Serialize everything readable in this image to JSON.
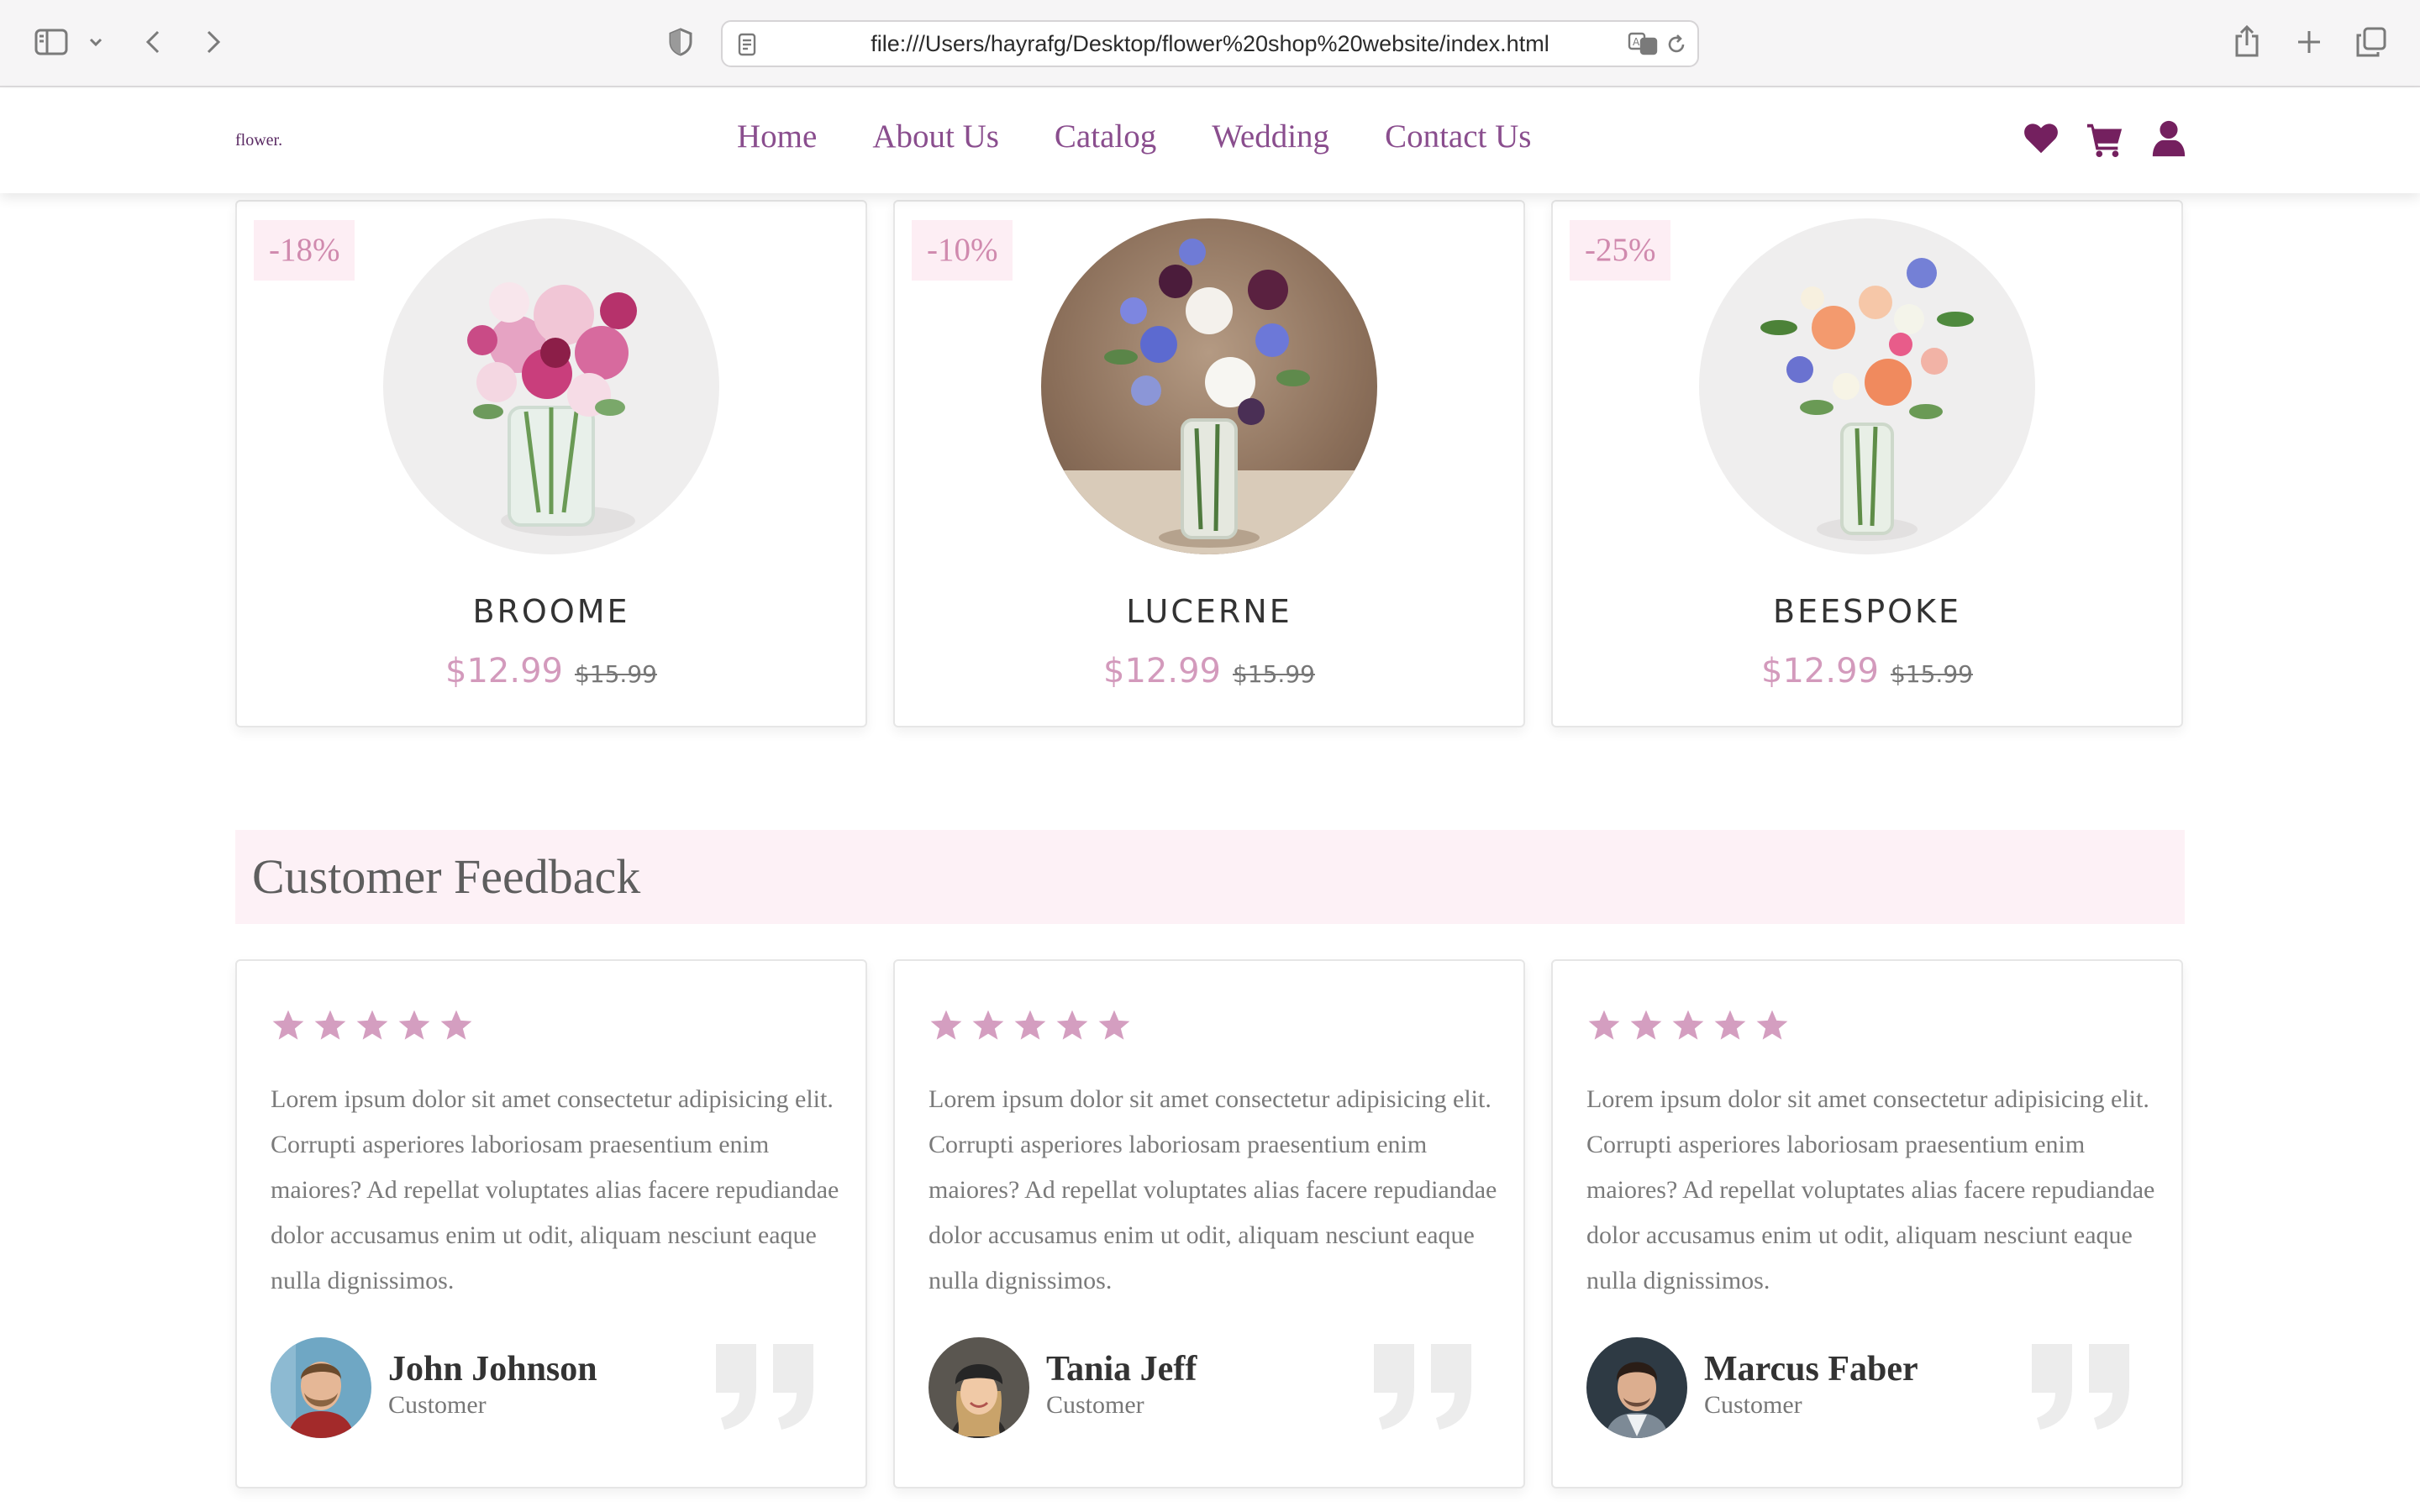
{
  "browser": {
    "url": "file:///Users/hayrafg/Desktop/flower%20shop%20website/index.html"
  },
  "header": {
    "logo": "flower.",
    "nav": [
      "Home",
      "About Us",
      "Catalog",
      "Wedding",
      "Contact Us"
    ],
    "icons": [
      "heart-icon",
      "cart-icon",
      "user-icon"
    ],
    "accent_color": "#74205f"
  },
  "products": [
    {
      "discount": "-18%",
      "name": "BROOME",
      "price": "$12.99",
      "old_price": "$15.99"
    },
    {
      "discount": "-10%",
      "name": "LUCERNE",
      "price": "$12.99",
      "old_price": "$15.99"
    },
    {
      "discount": "-25%",
      "name": "BEESPOKE",
      "price": "$12.99",
      "old_price": "$15.99"
    }
  ],
  "feedback": {
    "title": "Customer Feedback",
    "reviews": [
      {
        "rating": 5,
        "text": "Lorem ipsum dolor sit amet consectetur adipisicing elit. Corrupti asperiores laboriosam praesentium enim maiores? Ad repellat voluptates alias facere repudiandae dolor accusamus enim ut odit, aliquam nesciunt eaque nulla dignissimos.",
        "name": "John Johnson",
        "role": "Customer"
      },
      {
        "rating": 5,
        "text": "Lorem ipsum dolor sit amet consectetur adipisicing elit. Corrupti asperiores laboriosam praesentium enim maiores? Ad repellat voluptates alias facere repudiandae dolor accusamus enim ut odit, aliquam nesciunt eaque nulla dignissimos.",
        "name": "Tania Jeff",
        "role": "Customer"
      },
      {
        "rating": 5,
        "text": "Lorem ipsum dolor sit amet consectetur adipisicing elit. Corrupti asperiores laboriosam praesentium enim maiores? Ad repellat voluptates alias facere repudiandae dolor accusamus enim ut odit, aliquam nesciunt eaque nulla dignissimos.",
        "name": "Marcus Faber",
        "role": "Customer"
      }
    ]
  },
  "colors": {
    "discount_bg": "#fdeef4",
    "discount_text": "#d08aae",
    "price": "#d39abc",
    "star": "#d49ec0",
    "feedback_bar": "#fdf1f6"
  }
}
